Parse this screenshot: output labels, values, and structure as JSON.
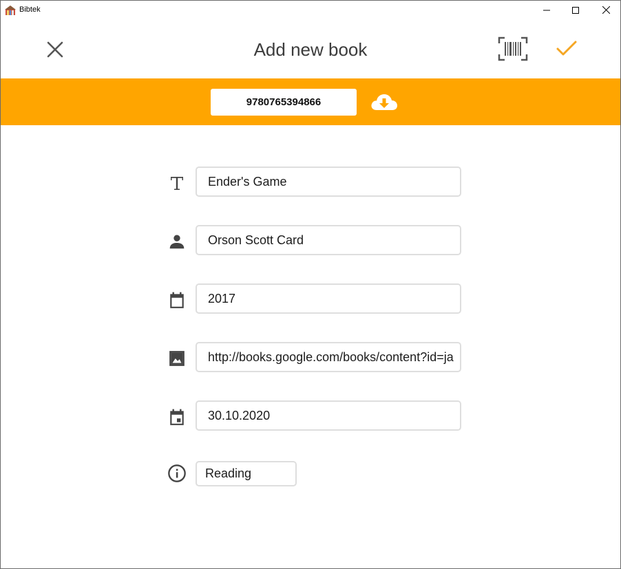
{
  "window": {
    "title": "Bibtek"
  },
  "header": {
    "title": "Add new book",
    "accent_color": "#f5a623"
  },
  "isbn_bar": {
    "background": "#ffa500",
    "isbn_value": "9780765394866"
  },
  "form": {
    "title_value": "Ender's Game",
    "author_value": "Orson Scott Card",
    "year_value": "2017",
    "cover_url_value": "http://books.google.com/books/content?id=ja",
    "date_value": "30.10.2020",
    "status_value": "Reading"
  },
  "icons": {
    "close": "close-icon",
    "barcode": "barcode-scan-icon",
    "confirm": "check-icon",
    "download": "cloud-download-icon",
    "title": "text-title-icon",
    "author": "person-icon",
    "year": "calendar-icon",
    "cover": "image-icon",
    "date": "calendar-event-icon",
    "status": "info-icon"
  }
}
